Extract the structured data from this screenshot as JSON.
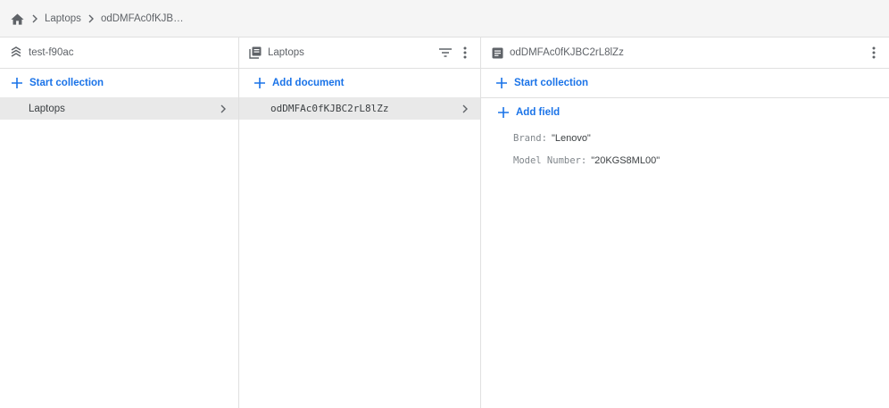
{
  "breadcrumb": {
    "home_icon": "home-icon",
    "items": [
      "Laptops",
      "odDMFAc0fKJB…"
    ]
  },
  "root_panel": {
    "icon": "database-icon",
    "title": "test-f90ac",
    "start_collection_label": "Start collection",
    "collections": [
      "Laptops"
    ]
  },
  "collection_panel": {
    "icon": "collection-icon",
    "title": "Laptops",
    "add_document_label": "Add document",
    "documents": [
      "odDMFAc0fKJBC2rL8lZz"
    ]
  },
  "document_panel": {
    "icon": "document-icon",
    "title": "odDMFAc0fKJBC2rL8lZz",
    "start_collection_label": "Start collection",
    "add_field_label": "Add field",
    "fields": [
      {
        "key": "Brand:",
        "value": "\"Lenovo\""
      },
      {
        "key": "Model Number:",
        "value": "\"20KGS8ML00\""
      }
    ]
  },
  "colors": {
    "accent": "#1a73e8",
    "selected_row": "#e9e9e9",
    "breadcrumb_bg": "#f5f5f5"
  }
}
